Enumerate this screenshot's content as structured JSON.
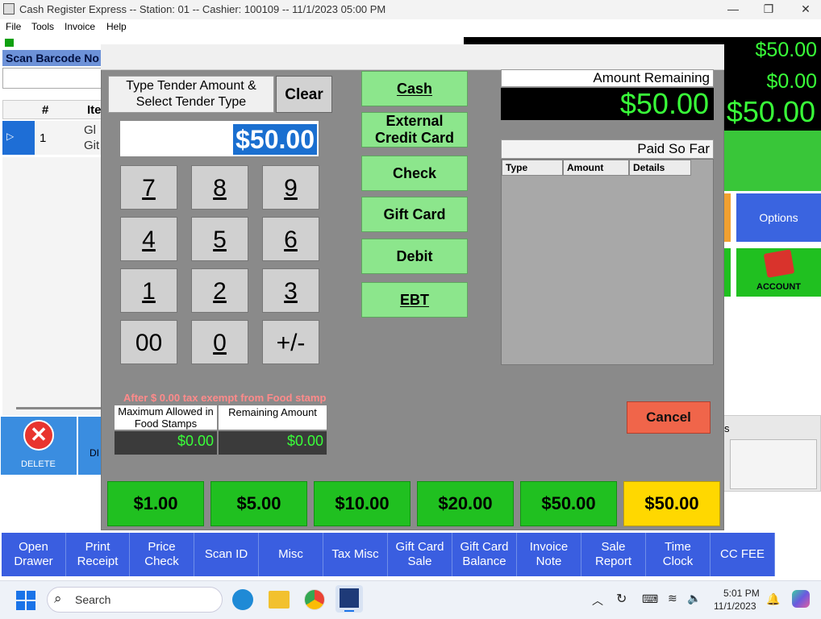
{
  "window": {
    "title": "Cash Register Express -- Station: 01 -- Cashier: 100109 -- 11/1/2023 05:00 PM",
    "min_label": "—",
    "max_label": "❐",
    "close_label": "✕"
  },
  "menu": [
    "File",
    "Tools",
    "Invoice",
    "Help"
  ],
  "background": {
    "scan_label": "Scan Barcode No",
    "grid_col_num": "#",
    "grid_col_item": "Ite",
    "row_num": "1",
    "row_item_line1": "Gl",
    "row_item_line2": "Git",
    "totals": [
      "$50.00",
      "$0.00",
      "$50.00"
    ],
    "options_label": "Options",
    "account_label": "ACCOUNT",
    "delete_label": "DELETE",
    "di_label": "DI",
    "right_panel_frag": "s"
  },
  "modal": {
    "tender_prompt_line1": "Type Tender Amount &",
    "tender_prompt_line2": "Select Tender Type",
    "clear_label": "Clear",
    "amount_value": "$50.00",
    "keypad": [
      "7",
      "8",
      "9",
      "4",
      "5",
      "6",
      "1",
      "2",
      "3",
      "00",
      "0",
      "+/-"
    ],
    "tenders": [
      {
        "line1": "Cash",
        "line2": "",
        "mnemonic": "C"
      },
      {
        "line1": "External",
        "line2": "Credit Card",
        "mnemonic": "r"
      },
      {
        "line1": "Check",
        "line2": "",
        "mnemonic": "h"
      },
      {
        "line1": "Gift Card",
        "line2": "",
        "mnemonic": "G"
      },
      {
        "line1": "Debit",
        "line2": "",
        "mnemonic": "D"
      },
      {
        "line1": "EBT",
        "line2": "",
        "mnemonic": "E"
      }
    ],
    "amount_remaining_label": "Amount Remaining",
    "amount_remaining_value": "$50.00",
    "paid_so_far_label": "Paid So Far",
    "paid_columns": [
      "Type",
      "Amount",
      "Details"
    ],
    "cancel_label": "Cancel",
    "food_note": "After $ 0.00 tax exempt from Food stamp",
    "food_max_label": "Maximum Allowed in Food Stamps",
    "food_max_value": "$0.00",
    "food_remaining_label": "Remaining Amount",
    "food_remaining_value": "$0.00",
    "quick_amounts": [
      "$1.00",
      "$5.00",
      "$10.00",
      "$20.00",
      "$50.00",
      "$50.00"
    ]
  },
  "toolbar": [
    {
      "line1": "Open",
      "line2": "Drawer"
    },
    {
      "line1": "Print",
      "line2": "Receipt"
    },
    {
      "line1": "Price",
      "line2": "Check"
    },
    {
      "line1": "Scan ID",
      "line2": ""
    },
    {
      "line1": "Misc",
      "line2": ""
    },
    {
      "line1": "Tax Misc",
      "line2": ""
    },
    {
      "line1": "Gift Card",
      "line2": "Sale"
    },
    {
      "line1": "Gift Card",
      "line2": "Balance"
    },
    {
      "line1": "Invoice",
      "line2": "Note"
    },
    {
      "line1": "Sale",
      "line2": "Report"
    },
    {
      "line1": "Time",
      "line2": "Clock"
    },
    {
      "line1": "CC FEE",
      "line2": ""
    }
  ],
  "taskbar": {
    "search_placeholder": "Search",
    "time": "5:01 PM",
    "date": "11/1/2023"
  },
  "colors": {
    "modal_bg": "#8a8a8a",
    "tender_green": "#8ce68c",
    "quick_green": "#20c020",
    "quick_yellow": "#ffd800",
    "toolbar_blue": "#3a5ee0",
    "cancel_red": "#f0654a"
  }
}
